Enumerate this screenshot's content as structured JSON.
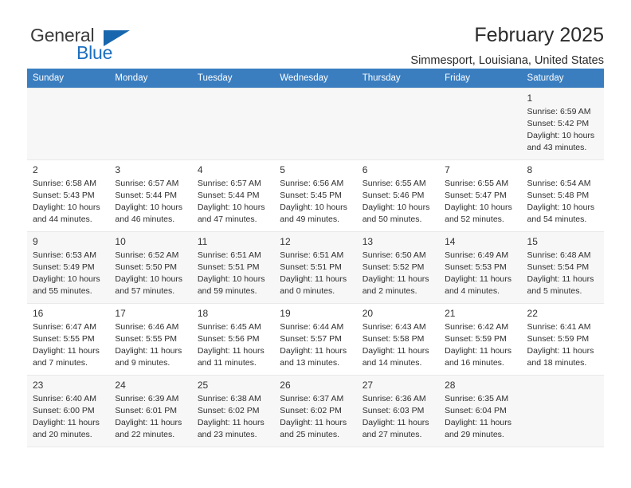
{
  "brand": {
    "name_part1": "General",
    "name_part2": "Blue",
    "accent_color": "#1766ae"
  },
  "header": {
    "title": "February 2025",
    "subtitle": "Simmesport, Louisiana, United States"
  },
  "calendar": {
    "header_bg": "#3a7ec0",
    "weekday_headers": [
      "Sunday",
      "Monday",
      "Tuesday",
      "Wednesday",
      "Thursday",
      "Friday",
      "Saturday"
    ],
    "weeks": [
      [
        {
          "day": "",
          "sunrise": "",
          "sunset": "",
          "daylight": "",
          "daylight2": ""
        },
        {
          "day": "",
          "sunrise": "",
          "sunset": "",
          "daylight": "",
          "daylight2": ""
        },
        {
          "day": "",
          "sunrise": "",
          "sunset": "",
          "daylight": "",
          "daylight2": ""
        },
        {
          "day": "",
          "sunrise": "",
          "sunset": "",
          "daylight": "",
          "daylight2": ""
        },
        {
          "day": "",
          "sunrise": "",
          "sunset": "",
          "daylight": "",
          "daylight2": ""
        },
        {
          "day": "",
          "sunrise": "",
          "sunset": "",
          "daylight": "",
          "daylight2": ""
        },
        {
          "day": "1",
          "sunrise": "Sunrise: 6:59 AM",
          "sunset": "Sunset: 5:42 PM",
          "daylight": "Daylight: 10 hours",
          "daylight2": "and 43 minutes."
        }
      ],
      [
        {
          "day": "2",
          "sunrise": "Sunrise: 6:58 AM",
          "sunset": "Sunset: 5:43 PM",
          "daylight": "Daylight: 10 hours",
          "daylight2": "and 44 minutes."
        },
        {
          "day": "3",
          "sunrise": "Sunrise: 6:57 AM",
          "sunset": "Sunset: 5:44 PM",
          "daylight": "Daylight: 10 hours",
          "daylight2": "and 46 minutes."
        },
        {
          "day": "4",
          "sunrise": "Sunrise: 6:57 AM",
          "sunset": "Sunset: 5:44 PM",
          "daylight": "Daylight: 10 hours",
          "daylight2": "and 47 minutes."
        },
        {
          "day": "5",
          "sunrise": "Sunrise: 6:56 AM",
          "sunset": "Sunset: 5:45 PM",
          "daylight": "Daylight: 10 hours",
          "daylight2": "and 49 minutes."
        },
        {
          "day": "6",
          "sunrise": "Sunrise: 6:55 AM",
          "sunset": "Sunset: 5:46 PM",
          "daylight": "Daylight: 10 hours",
          "daylight2": "and 50 minutes."
        },
        {
          "day": "7",
          "sunrise": "Sunrise: 6:55 AM",
          "sunset": "Sunset: 5:47 PM",
          "daylight": "Daylight: 10 hours",
          "daylight2": "and 52 minutes."
        },
        {
          "day": "8",
          "sunrise": "Sunrise: 6:54 AM",
          "sunset": "Sunset: 5:48 PM",
          "daylight": "Daylight: 10 hours",
          "daylight2": "and 54 minutes."
        }
      ],
      [
        {
          "day": "9",
          "sunrise": "Sunrise: 6:53 AM",
          "sunset": "Sunset: 5:49 PM",
          "daylight": "Daylight: 10 hours",
          "daylight2": "and 55 minutes."
        },
        {
          "day": "10",
          "sunrise": "Sunrise: 6:52 AM",
          "sunset": "Sunset: 5:50 PM",
          "daylight": "Daylight: 10 hours",
          "daylight2": "and 57 minutes."
        },
        {
          "day": "11",
          "sunrise": "Sunrise: 6:51 AM",
          "sunset": "Sunset: 5:51 PM",
          "daylight": "Daylight: 10 hours",
          "daylight2": "and 59 minutes."
        },
        {
          "day": "12",
          "sunrise": "Sunrise: 6:51 AM",
          "sunset": "Sunset: 5:51 PM",
          "daylight": "Daylight: 11 hours",
          "daylight2": "and 0 minutes."
        },
        {
          "day": "13",
          "sunrise": "Sunrise: 6:50 AM",
          "sunset": "Sunset: 5:52 PM",
          "daylight": "Daylight: 11 hours",
          "daylight2": "and 2 minutes."
        },
        {
          "day": "14",
          "sunrise": "Sunrise: 6:49 AM",
          "sunset": "Sunset: 5:53 PM",
          "daylight": "Daylight: 11 hours",
          "daylight2": "and 4 minutes."
        },
        {
          "day": "15",
          "sunrise": "Sunrise: 6:48 AM",
          "sunset": "Sunset: 5:54 PM",
          "daylight": "Daylight: 11 hours",
          "daylight2": "and 5 minutes."
        }
      ],
      [
        {
          "day": "16",
          "sunrise": "Sunrise: 6:47 AM",
          "sunset": "Sunset: 5:55 PM",
          "daylight": "Daylight: 11 hours",
          "daylight2": "and 7 minutes."
        },
        {
          "day": "17",
          "sunrise": "Sunrise: 6:46 AM",
          "sunset": "Sunset: 5:55 PM",
          "daylight": "Daylight: 11 hours",
          "daylight2": "and 9 minutes."
        },
        {
          "day": "18",
          "sunrise": "Sunrise: 6:45 AM",
          "sunset": "Sunset: 5:56 PM",
          "daylight": "Daylight: 11 hours",
          "daylight2": "and 11 minutes."
        },
        {
          "day": "19",
          "sunrise": "Sunrise: 6:44 AM",
          "sunset": "Sunset: 5:57 PM",
          "daylight": "Daylight: 11 hours",
          "daylight2": "and 13 minutes."
        },
        {
          "day": "20",
          "sunrise": "Sunrise: 6:43 AM",
          "sunset": "Sunset: 5:58 PM",
          "daylight": "Daylight: 11 hours",
          "daylight2": "and 14 minutes."
        },
        {
          "day": "21",
          "sunrise": "Sunrise: 6:42 AM",
          "sunset": "Sunset: 5:59 PM",
          "daylight": "Daylight: 11 hours",
          "daylight2": "and 16 minutes."
        },
        {
          "day": "22",
          "sunrise": "Sunrise: 6:41 AM",
          "sunset": "Sunset: 5:59 PM",
          "daylight": "Daylight: 11 hours",
          "daylight2": "and 18 minutes."
        }
      ],
      [
        {
          "day": "23",
          "sunrise": "Sunrise: 6:40 AM",
          "sunset": "Sunset: 6:00 PM",
          "daylight": "Daylight: 11 hours",
          "daylight2": "and 20 minutes."
        },
        {
          "day": "24",
          "sunrise": "Sunrise: 6:39 AM",
          "sunset": "Sunset: 6:01 PM",
          "daylight": "Daylight: 11 hours",
          "daylight2": "and 22 minutes."
        },
        {
          "day": "25",
          "sunrise": "Sunrise: 6:38 AM",
          "sunset": "Sunset: 6:02 PM",
          "daylight": "Daylight: 11 hours",
          "daylight2": "and 23 minutes."
        },
        {
          "day": "26",
          "sunrise": "Sunrise: 6:37 AM",
          "sunset": "Sunset: 6:02 PM",
          "daylight": "Daylight: 11 hours",
          "daylight2": "and 25 minutes."
        },
        {
          "day": "27",
          "sunrise": "Sunrise: 6:36 AM",
          "sunset": "Sunset: 6:03 PM",
          "daylight": "Daylight: 11 hours",
          "daylight2": "and 27 minutes."
        },
        {
          "day": "28",
          "sunrise": "Sunrise: 6:35 AM",
          "sunset": "Sunset: 6:04 PM",
          "daylight": "Daylight: 11 hours",
          "daylight2": "and 29 minutes."
        },
        {
          "day": "",
          "sunrise": "",
          "sunset": "",
          "daylight": "",
          "daylight2": ""
        }
      ]
    ]
  }
}
